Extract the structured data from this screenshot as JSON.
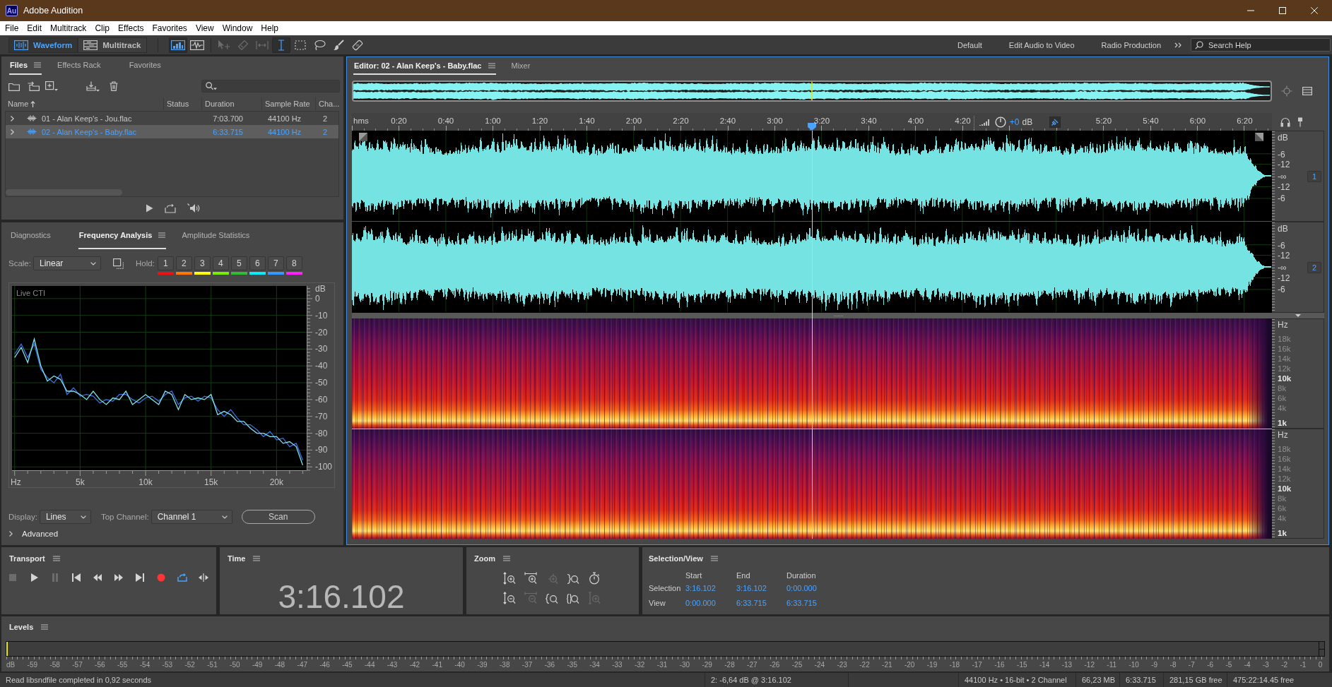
{
  "window": {
    "title": "Adobe Audition",
    "app_badge": "Au"
  },
  "menu": [
    "File",
    "Edit",
    "Multitrack",
    "Clip",
    "Effects",
    "Favorites",
    "View",
    "Window",
    "Help"
  ],
  "toolbar": {
    "views": [
      {
        "label": "Waveform",
        "selected": true
      },
      {
        "label": "Multitrack",
        "selected": false
      }
    ],
    "display_toggles": [
      {
        "selected": true
      },
      {
        "selected": false
      }
    ],
    "tools": [
      {
        "selected": false,
        "disabled": true
      },
      {
        "selected": false,
        "disabled": true
      },
      {
        "selected": false,
        "disabled": true
      },
      {
        "selected": true,
        "disabled": false
      },
      {
        "selected": false,
        "disabled": false
      },
      {
        "selected": false,
        "disabled": false
      },
      {
        "selected": false,
        "disabled": false
      },
      {
        "selected": false,
        "disabled": false
      }
    ],
    "workspaces": [
      "Default",
      "Edit Audio to Video",
      "Radio Production"
    ],
    "search": {
      "placeholder": "Search Help"
    }
  },
  "files_panel": {
    "tabs": [
      {
        "label": "Files",
        "selected": true
      },
      {
        "label": "Effects Rack",
        "selected": false
      },
      {
        "label": "Favorites",
        "selected": false
      }
    ],
    "columns": [
      {
        "label": "Name",
        "sorted": true
      },
      {
        "label": "Status",
        "sorted": false
      },
      {
        "label": "Duration",
        "sorted": false
      },
      {
        "label": "Sample Rate",
        "sorted": false
      },
      {
        "label": "Cha...",
        "sorted": false
      }
    ],
    "rows": [
      {
        "name": "01 - Alan Keep's - Jou.flac",
        "duration": "7:03.700",
        "sample_rate": "44100 Hz",
        "channels": "2",
        "selected": false,
        "expanded": false
      },
      {
        "name": "02 - Alan Keep's - Baby.flac",
        "duration": "6:33.715",
        "sample_rate": "44100 Hz",
        "channels": "2",
        "selected": true,
        "expanded": false
      }
    ]
  },
  "analysis_panel": {
    "tabs": [
      {
        "label": "Diagnostics",
        "selected": false
      },
      {
        "label": "Frequency Analysis",
        "selected": true
      },
      {
        "label": "Amplitude Statistics",
        "selected": false
      }
    ],
    "scale": {
      "label": "Scale:",
      "value": "Linear"
    },
    "hold": {
      "label": "Hold:",
      "slots": [
        {
          "label": "1",
          "color": "#ee1111"
        },
        {
          "label": "2",
          "color": "#ff7700"
        },
        {
          "label": "3",
          "color": "#ffff00"
        },
        {
          "label": "4",
          "color": "#77ee00"
        },
        {
          "label": "5",
          "color": "#33bb33"
        },
        {
          "label": "6",
          "color": "#00eeff"
        },
        {
          "label": "7",
          "color": "#3399ff"
        },
        {
          "label": "8",
          "color": "#ff22ff"
        }
      ]
    },
    "chart_caption": "Live CTI",
    "chart_data": {
      "type": "line",
      "grid": true,
      "xlabel": "Hz",
      "ylabel": "dB",
      "x": [
        0,
        500,
        1000,
        1500,
        2000,
        2500,
        3000,
        3500,
        4000,
        4500,
        5000,
        5500,
        6000,
        6500,
        7000,
        7500,
        8000,
        8500,
        9000,
        9500,
        10000,
        10500,
        11000,
        11500,
        12000,
        12500,
        13000,
        13500,
        14000,
        14500,
        15000,
        15500,
        16000,
        16500,
        17000,
        17500,
        18000,
        18500,
        19000,
        19500,
        20000,
        20500,
        21000,
        21500,
        22000
      ],
      "series": [
        {
          "color": "#3f6ee0",
          "values": [
            -33,
            -27,
            -35,
            -27,
            -42,
            -47,
            -50,
            -45,
            -57,
            -53,
            -58,
            -57,
            -58,
            -62,
            -60,
            -61,
            -57,
            -57,
            -60,
            -62,
            -59,
            -58,
            -61,
            -57,
            -55,
            -63,
            -59,
            -58,
            -61,
            -58,
            -59,
            -66,
            -70,
            -66,
            -71,
            -75,
            -75,
            -78,
            -82,
            -79,
            -84,
            -83,
            -88,
            -86,
            -96
          ]
        },
        {
          "color": "#7fe3ec",
          "values": [
            -35,
            -29,
            -38,
            -24,
            -40,
            -49,
            -46,
            -48,
            -55,
            -55,
            -57,
            -60,
            -55,
            -60,
            -63,
            -59,
            -60,
            -55,
            -63,
            -60,
            -57,
            -60,
            -63,
            -55,
            -57,
            -66,
            -57,
            -60,
            -59,
            -60,
            -57,
            -69,
            -67,
            -69,
            -73,
            -73,
            -77,
            -80,
            -80,
            -82,
            -82,
            -86,
            -85,
            -88,
            -99
          ]
        }
      ],
      "xlim": [
        -200,
        22300
      ],
      "ylim": [
        -102,
        7.5
      ],
      "xticks": [
        {
          "value": 5000,
          "label": "5k"
        },
        {
          "value": 10000,
          "label": "10k"
        },
        {
          "value": 15000,
          "label": "15k"
        },
        {
          "value": 20000,
          "label": "20k"
        }
      ],
      "yticks": [
        0,
        -10,
        -20,
        -30,
        -40,
        -50,
        -60,
        -70,
        -80,
        -90,
        -100
      ]
    },
    "display": {
      "label": "Display:",
      "value": "Lines"
    },
    "top_channel": {
      "label": "Top Channel:",
      "value": "Channel 1"
    },
    "scan_button": "Scan",
    "advanced": {
      "label": "Advanced",
      "expanded": false
    }
  },
  "editor": {
    "tabs": [
      {
        "label": "Editor: 02 - Alan Keep's - Baby.flac",
        "selected": true
      },
      {
        "label": "Mixer",
        "selected": false
      }
    ],
    "playhead": {
      "level": 0.5
    },
    "ruler": {
      "unit": "hms",
      "labels_before_gain": [
        "0:20",
        "0:40",
        "1:00",
        "1:20",
        "1:40",
        "2:00",
        "2:20",
        "2:40",
        "3:00",
        "3:20",
        "3:40",
        "4:00",
        "4:20"
      ],
      "labels_after_gain": [
        "5:20",
        "5:40",
        "6:00",
        "6:20"
      ]
    },
    "gain": {
      "value": "+0",
      "unit": "dB"
    },
    "channels": [
      {
        "badge": "1",
        "scale": [
          "dB",
          "-6",
          "-12",
          "-∞",
          "-12",
          "-6"
        ]
      },
      {
        "badge": "2",
        "scale": [
          "dB",
          "-6",
          "-12",
          "-∞",
          "-12",
          "-6"
        ]
      }
    ],
    "spectral_scales": [
      {
        "unit": "Hz",
        "ticks": [
          {
            "label": "18k",
            "major": false
          },
          {
            "label": "16k",
            "major": false
          },
          {
            "label": "14k",
            "major": false
          },
          {
            "label": "12k",
            "major": false
          },
          {
            "label": "10k",
            "major": true
          },
          {
            "label": "8k",
            "major": false
          },
          {
            "label": "6k",
            "major": false
          },
          {
            "label": "4k",
            "major": false
          },
          {
            "label": "1k",
            "major": true
          }
        ]
      },
      {
        "unit": "Hz",
        "ticks": [
          {
            "label": "18k",
            "major": false
          },
          {
            "label": "16k",
            "major": false
          },
          {
            "label": "14k",
            "major": false
          },
          {
            "label": "12k",
            "major": false
          },
          {
            "label": "10k",
            "major": true
          },
          {
            "label": "8k",
            "major": false
          },
          {
            "label": "6k",
            "major": false
          },
          {
            "label": "4k",
            "major": false
          },
          {
            "label": "1k",
            "major": true
          }
        ]
      }
    ]
  },
  "transport": {
    "title": "Transport",
    "buttons": [
      {
        "disabled": true,
        "on": false
      },
      {
        "disabled": false,
        "on": false
      },
      {
        "disabled": true,
        "on": false
      },
      {
        "disabled": false,
        "on": false
      },
      {
        "disabled": false,
        "on": false
      },
      {
        "disabled": false,
        "on": false
      },
      {
        "disabled": false,
        "on": false
      },
      {
        "disabled": false,
        "on": false
      },
      {
        "disabled": false,
        "on": true
      },
      {
        "disabled": false,
        "on": false
      }
    ]
  },
  "time_panel": {
    "title": "Time",
    "value": "3:16.102"
  },
  "zoom_panel": {
    "title": "Zoom",
    "buttons": [
      {
        "disabled": false
      },
      {
        "disabled": false
      },
      {
        "disabled": true
      },
      {
        "disabled": false
      },
      {
        "disabled": false
      },
      {
        "disabled": false
      },
      {
        "disabled": true
      },
      {
        "disabled": false
      },
      {
        "disabled": false
      },
      {
        "disabled": true
      }
    ]
  },
  "selection_view": {
    "title": "Selection/View",
    "columns": [
      "Start",
      "End",
      "Duration"
    ],
    "rows": [
      {
        "label": "Selection",
        "values": [
          "3:16.102",
          "3:16.102",
          "0:00.000"
        ]
      },
      {
        "label": "View",
        "values": [
          "0:00.000",
          "6:33.715",
          "6:33.715"
        ]
      }
    ]
  },
  "levels": {
    "title": "Levels",
    "meter": {
      "level": 0
    },
    "scale": [
      "dB",
      "-59",
      "-58",
      "-57",
      "-56",
      "-55",
      "-54",
      "-53",
      "-52",
      "-51",
      "-50",
      "-49",
      "-48",
      "-47",
      "-46",
      "-45",
      "-44",
      "-43",
      "-42",
      "-41",
      "-40",
      "-39",
      "-38",
      "-37",
      "-36",
      "-35",
      "-34",
      "-33",
      "-32",
      "-31",
      "-30",
      "-29",
      "-28",
      "-27",
      "-26",
      "-25",
      "-24",
      "-23",
      "-22",
      "-21",
      "-20",
      "-19",
      "-18",
      "-17",
      "-16",
      "-15",
      "-14",
      "-13",
      "-12",
      "-11",
      "-10",
      "-9",
      "-8",
      "-7",
      "-6",
      "-5",
      "-4",
      "-3",
      "-2",
      "-1",
      "0"
    ]
  },
  "status_bar": {
    "message": "Read libsndfile completed in 0,92 seconds",
    "segments": [
      "2: -6,64 dB @ 3:16.102",
      "44100 Hz • 16-bit • 2 Channel",
      "66,23 MB",
      "6:33.715",
      "281,15 GB free",
      "475:22:14.45 free"
    ]
  }
}
